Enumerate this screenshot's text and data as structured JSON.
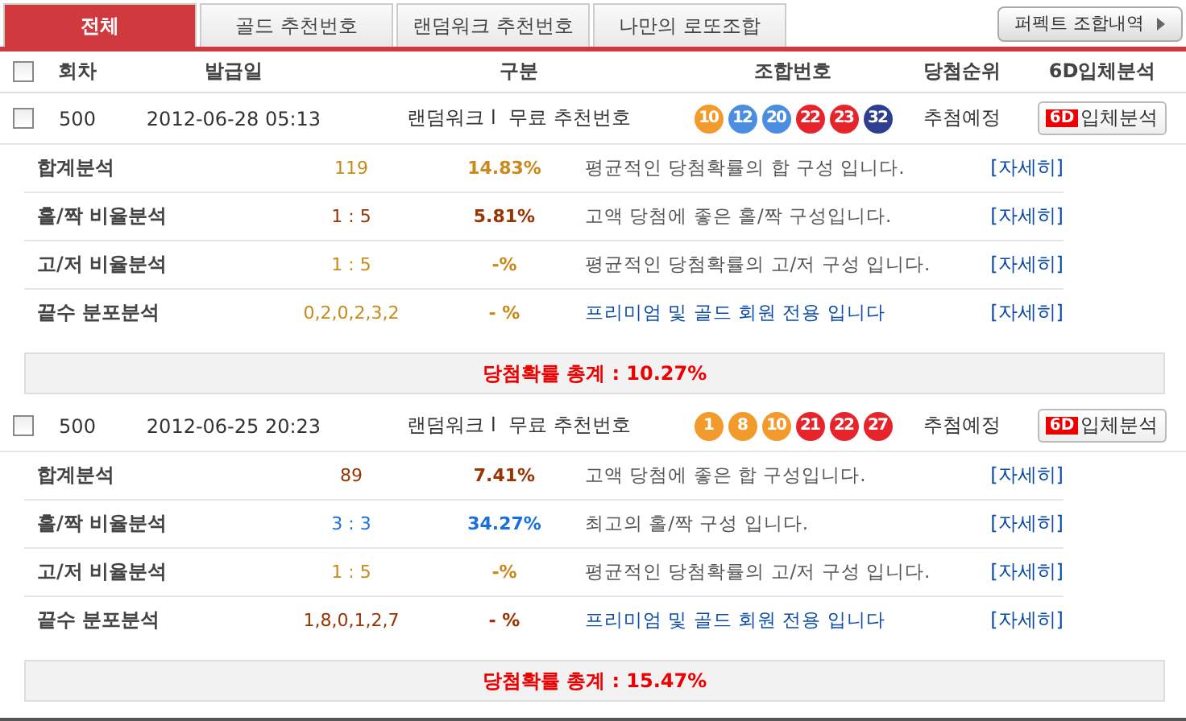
{
  "tabs": [
    {
      "label": "전체",
      "selected": true
    },
    {
      "label": "골드 추천번호",
      "selected": false
    },
    {
      "label": "랜덤워크 추천번호",
      "selected": false
    },
    {
      "label": "나만의 로또조합",
      "selected": false
    }
  ],
  "perfect_button": "퍼펙트 조합내역",
  "columns": [
    "회차",
    "발급일",
    "구분",
    "조합번호",
    "당첨순위",
    "6D입체분석"
  ],
  "header_checked": false,
  "records": [
    {
      "checked": false,
      "round": "500",
      "date": "2012-06-28 05:13",
      "category": "랜덤워크 l  무료 추천번호",
      "balls": [
        {
          "n": "10",
          "color": "#f39a2c"
        },
        {
          "n": "12",
          "color": "#4b8de0"
        },
        {
          "n": "20",
          "color": "#4b8de0"
        },
        {
          "n": "22",
          "color": "#e5252b"
        },
        {
          "n": "23",
          "color": "#e5252b"
        },
        {
          "n": "32",
          "color": "#2e3f8f"
        }
      ],
      "rank": "추첨예정",
      "badge": "6D",
      "button": "입체분석",
      "analyses": [
        {
          "kind": "plain",
          "label": "합계분석",
          "value": {
            "text": "119",
            "color": "#c98a1a"
          },
          "percent": {
            "text": "14.83%",
            "color": "#c98a1a"
          },
          "desc": "평균적인 당첨확률의 합 구성 입니다.",
          "link": "[자세히]"
        },
        {
          "kind": "plain",
          "label": "홀/짝 비율분석",
          "value": {
            "text": "1 : 5",
            "color": "#993300"
          },
          "percent": {
            "text": "5.81%",
            "color": "#993300"
          },
          "desc": "고액 당첨에 좋은 홀/짝 구성입니다.",
          "link": "[자세히]"
        },
        {
          "kind": "plain",
          "label": "고/저 비율분석",
          "value": {
            "text": "1 : 5",
            "color": "#c98a1a"
          },
          "percent": {
            "text": "-%",
            "color": "#c98a1a"
          },
          "desc": "평균적인 당첨확률의 고/저 구성 입니다.",
          "link": "[자세히]"
        },
        {
          "kind": "premium",
          "label": "끝수 분포분석",
          "value": {
            "text": "0,2,0,2,3,2",
            "color": "#c98a1a"
          },
          "percent": {
            "text": "- %",
            "color": "#c98a1a"
          },
          "desc": "프리미엄 및 골드 회원 전용 입니다",
          "link": "[자세히]"
        }
      ],
      "total": "당첨확률 총계 : 10.27%"
    },
    {
      "checked": false,
      "round": "500",
      "date": "2012-06-25 20:23",
      "category": "랜덤워크 l  무료 추천번호",
      "balls": [
        {
          "n": "1",
          "color": "#f39a2c"
        },
        {
          "n": "8",
          "color": "#f39a2c"
        },
        {
          "n": "10",
          "color": "#f39a2c"
        },
        {
          "n": "21",
          "color": "#e5252b"
        },
        {
          "n": "22",
          "color": "#e5252b"
        },
        {
          "n": "27",
          "color": "#e5252b"
        }
      ],
      "rank": "추첨예정",
      "badge": "6D",
      "button": "입체분석",
      "analyses": [
        {
          "kind": "plain",
          "label": "합계분석",
          "value": {
            "text": "89",
            "color": "#993300"
          },
          "percent": {
            "text": "7.41%",
            "color": "#993300"
          },
          "desc": "고액 당첨에 좋은 합 구성입니다.",
          "link": "[자세히]"
        },
        {
          "kind": "plain",
          "label": "홀/짝 비율분석",
          "value": {
            "text": "3 : 3",
            "color": "#1a6fd8"
          },
          "percent": {
            "text": "34.27%",
            "color": "#1a6fd8"
          },
          "desc": "최고의 홀/짝 구성 입니다.",
          "link": "[자세히]"
        },
        {
          "kind": "plain",
          "label": "고/저 비율분석",
          "value": {
            "text": "1 : 5",
            "color": "#c98a1a"
          },
          "percent": {
            "text": "-%",
            "color": "#c98a1a"
          },
          "desc": "평균적인 당첨확률의 고/저 구성 입니다.",
          "link": "[자세히]"
        },
        {
          "kind": "premium",
          "label": "끝수 분포분석",
          "value": {
            "text": "1,8,0,1,2,7",
            "color": "#993300"
          },
          "percent": {
            "text": "- %",
            "color": "#993300"
          },
          "desc": "프리미엄 및 골드 회원 전용 입니다",
          "link": "[자세히]"
        }
      ],
      "total": "당첨확률 총계 : 15.47%"
    }
  ]
}
